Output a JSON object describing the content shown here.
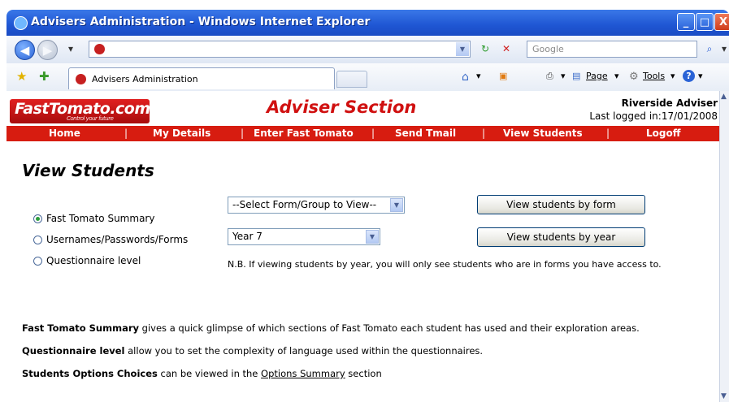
{
  "window": {
    "title": "Advisers Administration - Windows Internet Explorer",
    "minimize_label": "_",
    "maximize_label": "□",
    "close_label": "X"
  },
  "address_bar": {
    "url": "",
    "search_placeholder": "Google"
  },
  "tabbar": {
    "tab_label": "Advisers Administration",
    "page_menu": "Page",
    "tools_menu": "Tools"
  },
  "header": {
    "logo_text": "FastTomato.com",
    "logo_tagline": "Control your future",
    "section_title": "Adviser Section",
    "adviser_name": "Riverside Adviser",
    "last_logged_in": "Last logged in:17/01/2008"
  },
  "nav": {
    "items": [
      "Home",
      "My Details",
      "Enter Fast Tomato",
      "Send Tmail",
      "View Students",
      "Logoff"
    ],
    "separator": "|"
  },
  "main": {
    "title": "View Students",
    "radios": [
      {
        "label": "Fast Tomato Summary",
        "checked": true
      },
      {
        "label": "Usernames/Passwords/Forms",
        "checked": false
      },
      {
        "label": "Questionnaire level",
        "checked": false
      }
    ],
    "form_select_value": "--Select Form/Group to View--",
    "year_select_value": "Year 7",
    "view_by_form_button": "View students by form",
    "view_by_year_button": "View students by year",
    "note": "N.B. If viewing students by year, you will only see students who are in forms you have access to.",
    "info": [
      {
        "bold": "Fast Tomato Summary",
        "text": " gives a quick glimpse of which sections of Fast Tomato each student has used and their exploration areas."
      },
      {
        "bold": "Questionnaire level",
        "text": " allow you to set the complexity of language used within the questionnaires."
      },
      {
        "bold": "Students Options Choices",
        "text": " can be viewed in the ",
        "link": "Options Summary",
        "tail": " section"
      }
    ]
  }
}
